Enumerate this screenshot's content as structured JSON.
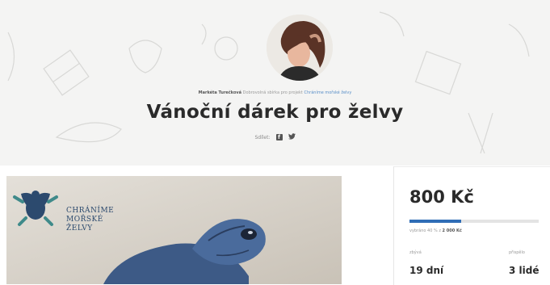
{
  "header": {
    "author": "Markéta Turečková",
    "byline_text": "Dobrovolná sbírka pro projekt",
    "project_link": "Chráníme mořské želvy"
  },
  "campaign": {
    "title": "Vánoční dárek pro želvy",
    "share_label": "Sdílet:",
    "share_icons": [
      "facebook-icon",
      "twitter-icon"
    ]
  },
  "image": {
    "logo_lines": [
      "CHRÁNÍME",
      "MOŘSKÉ",
      "ŽELVY"
    ]
  },
  "donation": {
    "amount": "800 Kč",
    "progress_fraction": 0.4,
    "collected_text": "vybráno 40 % z",
    "target": "2 000 Kč",
    "stats": [
      {
        "label": "zbývá",
        "value": "19 dní"
      },
      {
        "label": "přispělo",
        "value": "3 lidé"
      }
    ]
  },
  "colors": {
    "accent": "#2f6db6",
    "logo": "#2c4a6e",
    "hero_bg": "#f4f4f3"
  }
}
